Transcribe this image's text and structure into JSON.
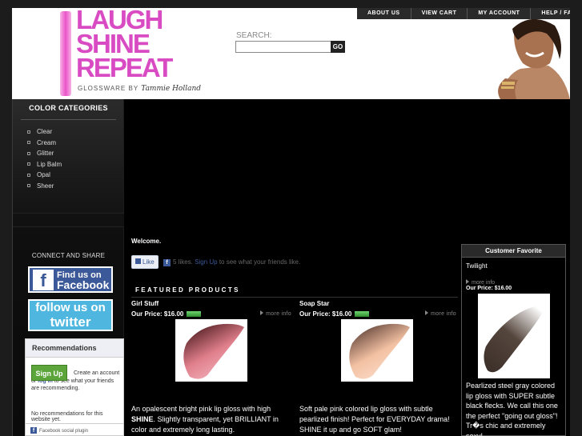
{
  "header": {
    "logo_lines": [
      "LAUGH",
      "SHINE",
      "REPEAT"
    ],
    "logo_sub": "GLOSSWARE BY",
    "logo_signature": "Tammie Holland",
    "search_label": "SEARCH:",
    "search_value": "",
    "search_button": "GO",
    "nav": [
      "ABOUT US",
      "VIEW CART",
      "MY ACCOUNT",
      "HELP / FAQ"
    ]
  },
  "sidebar": {
    "categories_title": "COLOR CATEGORIES",
    "categories": [
      "Clear",
      "Cream",
      "Glitter",
      "Lip Balm",
      "Opal",
      "Sheer"
    ],
    "connect_title": "CONNECT AND SHARE",
    "facebook_badge": {
      "line1": "Find us on",
      "line2": "Facebook"
    },
    "twitter_badge": {
      "line1": "follow us on",
      "line2": "twitter"
    },
    "recommendations": {
      "title": "Recommendations",
      "signup": "Sign Up",
      "text_before": "Create an account or ",
      "login": "log in",
      "text_after": " to see what your friends are recommending.",
      "none": "No recommendations for this website yet.",
      "footer": "Facebook social plugin"
    }
  },
  "main": {
    "welcome": "Welcome.",
    "like_button": "Like",
    "like_count": "5 likes.",
    "like_signup": "Sign Up",
    "like_suffix": " to see what your friends like.",
    "featured_title": "FEATURED PRODUCTS",
    "products": [
      {
        "name": "Girl Stuff",
        "price_label": "Our Price: $16.00",
        "more": "more info",
        "swatch_color": "#e07f8c",
        "desc_start": "An opalescent bright pink lip gloss with high ",
        "desc_bold": "SHINE",
        "desc_end": ".  Slightly transparent, yet BRILLIANT in color and extremely long lasting."
      },
      {
        "name": "Soap Star",
        "price_label": "Our Price: $16.00",
        "more": "more info",
        "swatch_color": "#f3c1a3",
        "desc_start": "Soft pale pink colored lip gloss with subtle pearlized finish! Perfect for EVERYDAY drama! SHINE it up and go SOFT glam!",
        "desc_bold": "",
        "desc_end": ""
      }
    ],
    "favorite": {
      "title": "Customer Favorite",
      "name": "Twilight",
      "more": "more info",
      "price_label": "Our Price: $16.00",
      "swatch_color": "#55463d",
      "desc": "Pearlized steel gray colored lip gloss with SUPER subtle black flecks. We call this one the perfect \"going out gloss\"! Tr�s chic and extremely sexy!"
    }
  }
}
